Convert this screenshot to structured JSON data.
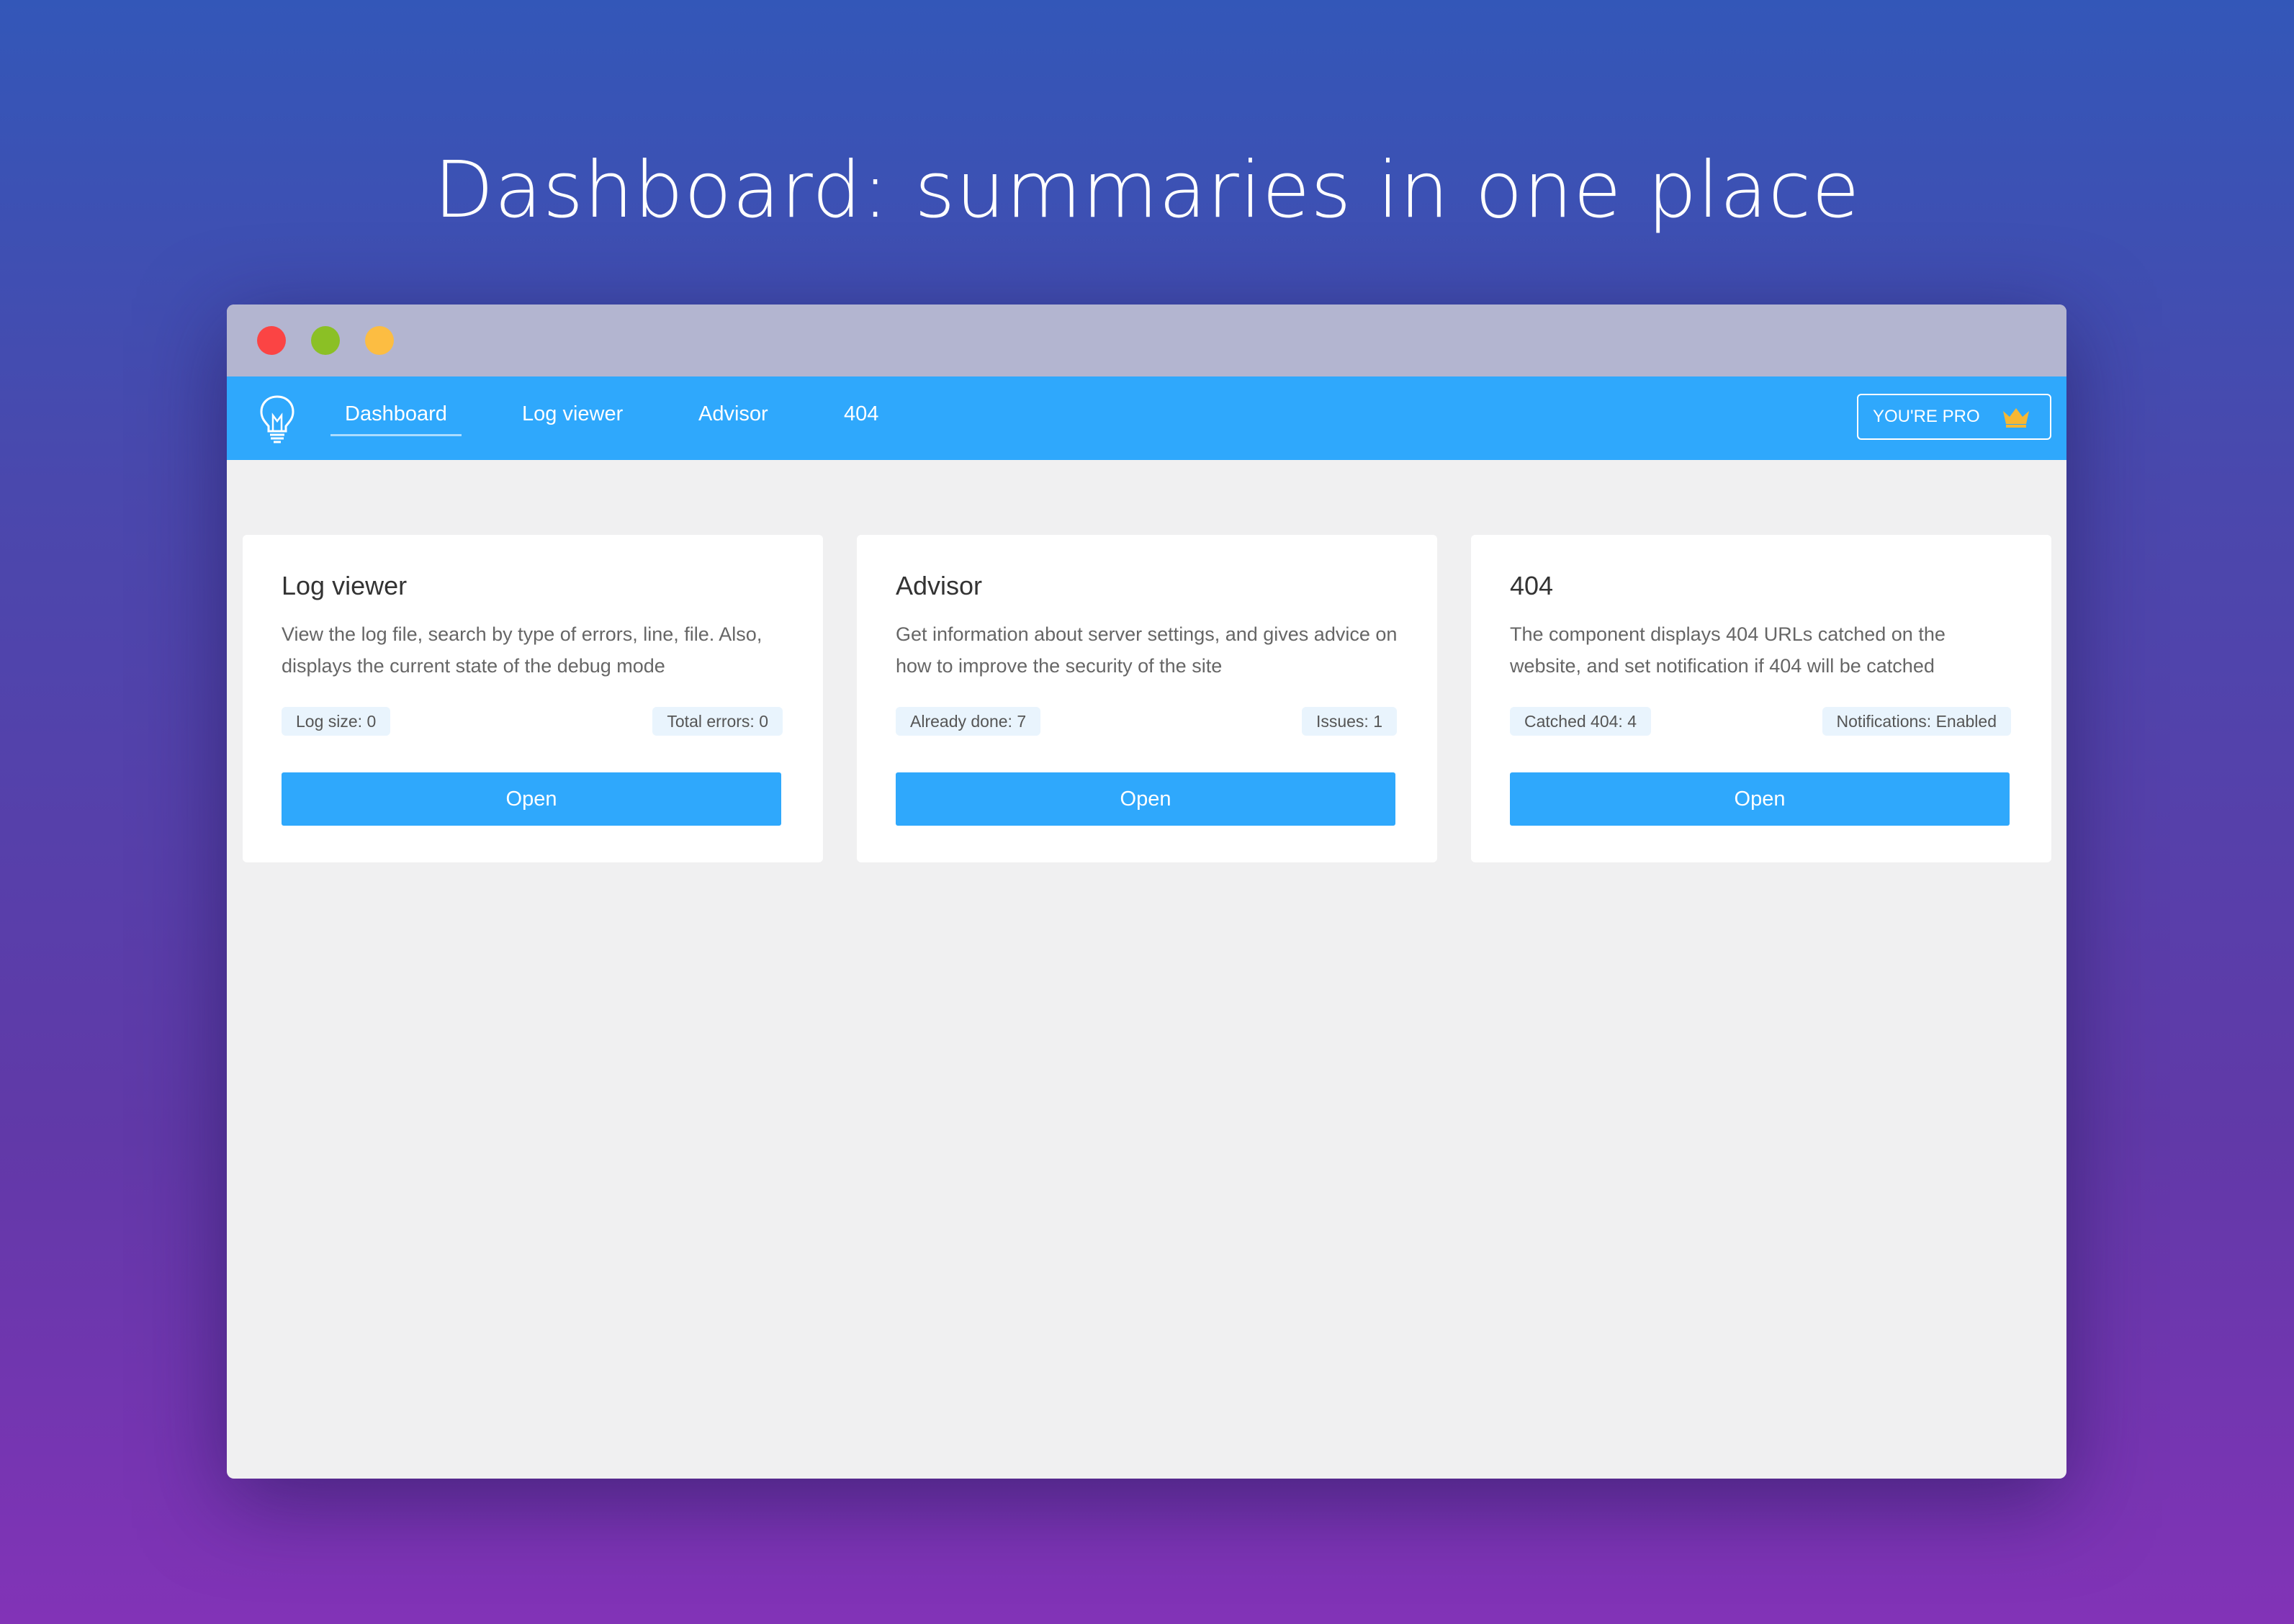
{
  "headline": "Dashboard: summaries in one place",
  "colors": {
    "navbar": "#2fa8fc",
    "button": "#2fa8fc",
    "tag_bg": "#e9f4fd",
    "window_bg": "#f0f0f1",
    "titlebar": "#b3b5d0",
    "close_dot": "#fb4444",
    "minimize_dot": "#8bc025",
    "zoom_dot": "#fcbd42",
    "crown": "#f7b733"
  },
  "navbar": {
    "logo_icon": "lightbulb-icon",
    "items": [
      {
        "label": "Dashboard",
        "active": true
      },
      {
        "label": "Log viewer",
        "active": false
      },
      {
        "label": "Advisor",
        "active": false
      },
      {
        "label": "404",
        "active": false
      }
    ],
    "pro_badge": {
      "label": "YOU'RE PRO",
      "icon": "crown-icon"
    }
  },
  "cards": [
    {
      "title": "Log viewer",
      "description": "View the log file, search by type of errors, line, file. Also, displays the current state of the debug mode",
      "tag_left": "Log size: 0",
      "tag_right": "Total errors: 0",
      "button": "Open"
    },
    {
      "title": "Advisor",
      "description": "Get information about server settings, and gives advice on how to improve the security of the site",
      "tag_left": "Already done: 7",
      "tag_right": "Issues: 1",
      "button": "Open"
    },
    {
      "title": "404",
      "description": "The component displays 404 URLs catched on the website, and set notification if 404 will be catched",
      "tag_left": "Catched 404: 4",
      "tag_right": "Notifications: Enabled",
      "button": "Open"
    }
  ]
}
